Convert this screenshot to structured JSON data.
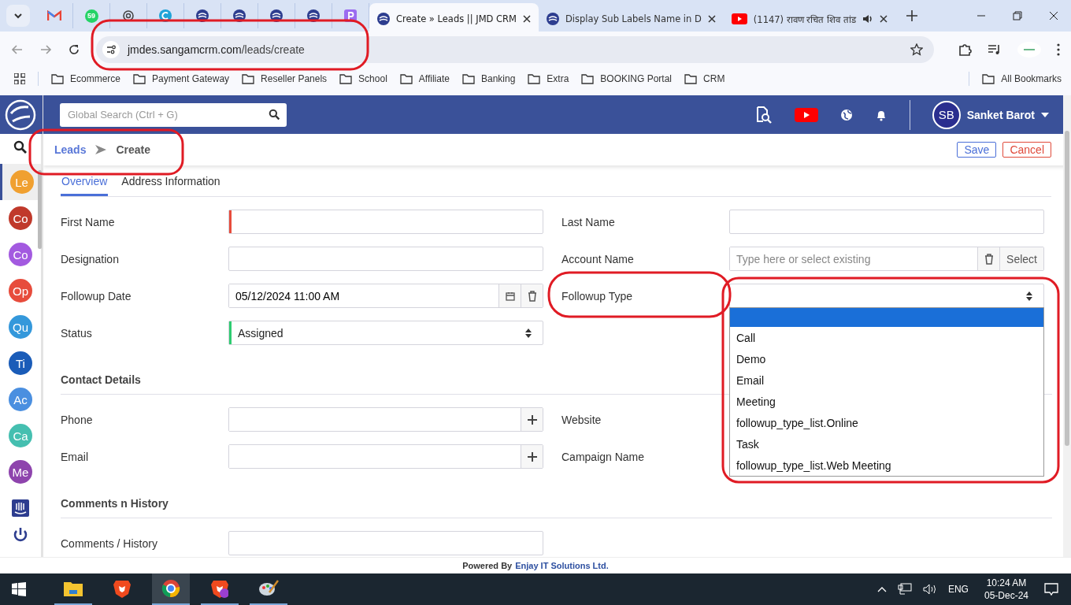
{
  "browser": {
    "pinned_tabs": [
      {
        "kind": "mail"
      },
      {
        "kind": "chat",
        "badge": "59"
      },
      {
        "kind": "knot"
      },
      {
        "kind": "letter"
      },
      {
        "kind": "crm"
      },
      {
        "kind": "crm"
      },
      {
        "kind": "crm"
      },
      {
        "kind": "crm"
      },
      {
        "kind": "square"
      }
    ],
    "tabs": [
      {
        "title": "Create » Leads || JMD CRM",
        "kind": "crm",
        "selected": true
      },
      {
        "title": "Display Sub Labels Name in D",
        "kind": "crm",
        "selected": false
      },
      {
        "title": "(1147) रावण रचित शिव तांड",
        "kind": "video",
        "selected": false
      }
    ],
    "url_host": "jmdes.sangamcrm.com",
    "url_path": "/leads/create",
    "bookmarks": [
      "Ecommerce",
      "Payment Gateway",
      "Reseller Panels",
      "School",
      "Affiliate",
      "Banking",
      "Extra",
      "BOOKING Portal",
      "CRM"
    ],
    "all_bookmarks": "All Bookmarks"
  },
  "header": {
    "search_placeholder": "Global Search (Ctrl + G)",
    "user_initials": "SB",
    "user_name": "Sanket Barot"
  },
  "sidebar": {
    "items": [
      {
        "initials": "Le",
        "color": "#f0a030",
        "selected": true
      },
      {
        "initials": "Co",
        "color": "#c0392b",
        "selected": false
      },
      {
        "initials": "Co",
        "color": "#a35ae0",
        "selected": false
      },
      {
        "initials": "Op",
        "color": "#e74c3c",
        "selected": false
      },
      {
        "initials": "Qu",
        "color": "#3498db",
        "selected": false
      },
      {
        "initials": "Ti",
        "color": "#1a5cb8",
        "selected": false
      },
      {
        "initials": "Ac",
        "color": "#4a8fe0",
        "selected": false
      },
      {
        "initials": "Ca",
        "color": "#45bfb0",
        "selected": false
      },
      {
        "initials": "Me",
        "color": "#8e44ad",
        "selected": false
      }
    ]
  },
  "breadcrumb": {
    "parent": "Leads",
    "current": "Create"
  },
  "actions": {
    "save": "Save",
    "cancel": "Cancel"
  },
  "form_tabs": [
    {
      "label": "Overview",
      "selected": true
    },
    {
      "label": "Address Information",
      "selected": false
    }
  ],
  "sections": [
    {
      "fields": [
        {
          "label": "First Name",
          "kind": "text",
          "color": "#e74c3c"
        },
        {
          "label": "Last Name",
          "kind": "text"
        },
        {
          "label": "Designation",
          "kind": "text"
        },
        {
          "label": "Account Name",
          "kind": "lookup",
          "placeholder": "Type here or select existing",
          "button": "Select"
        },
        {
          "label": "Followup Date",
          "kind": "date",
          "value": "05/12/2024 11:00 AM"
        },
        {
          "label": "Followup Type",
          "kind": "dropdown"
        },
        {
          "label": "Status",
          "kind": "select",
          "value": "Assigned",
          "color": "#2ecc71"
        }
      ]
    },
    {
      "title": "Contact Details",
      "fields": [
        {
          "label": "Phone",
          "kind": "plus"
        },
        {
          "label": "Website",
          "kind": "covered"
        },
        {
          "label": "Email",
          "kind": "plus"
        },
        {
          "label": "Campaign Name",
          "kind": "covered"
        }
      ]
    },
    {
      "title": "Comments n History",
      "fields": [
        {
          "label": "Comments / History",
          "kind": "textarea"
        }
      ]
    }
  ],
  "dropdown": {
    "blank_selected": true,
    "options": [
      {
        "label": "Call",
        "selected": false
      },
      {
        "label": "Demo",
        "selected": false
      },
      {
        "label": "Email",
        "selected": false
      },
      {
        "label": "Meeting",
        "selected": false
      },
      {
        "label": "followup_type_list.Online",
        "selected": false
      },
      {
        "label": "Task",
        "selected": false
      },
      {
        "label": "followup_type_list.Web Meeting",
        "selected": false
      }
    ]
  },
  "footer": {
    "prefix": "Powered By",
    "company": "Enjay IT Solutions Ltd."
  },
  "taskbar": {
    "apps": [
      {
        "kind": "folder",
        "selected": false
      },
      {
        "kind": "lion",
        "selected": false
      },
      {
        "kind": "chrome",
        "selected": true
      },
      {
        "kind": "lion-private",
        "selected": false
      },
      {
        "kind": "palette",
        "selected": false
      }
    ],
    "language": "ENG",
    "time": "10:24 AM",
    "date": "05-Dec-24"
  }
}
